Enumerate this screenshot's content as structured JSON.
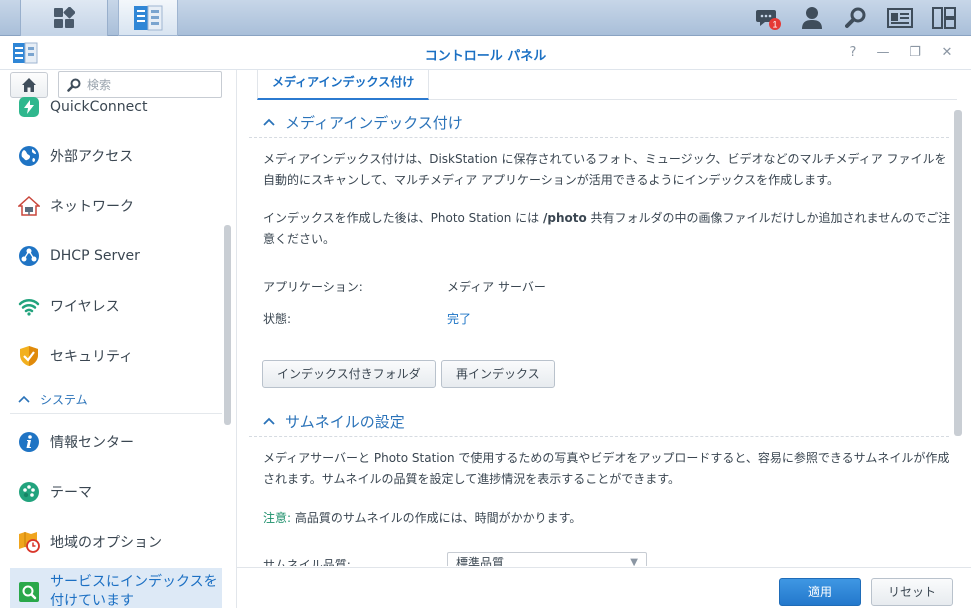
{
  "window": {
    "title": "コントロール パネル",
    "help": "?",
    "minimize": "—",
    "restore": "❐",
    "close": "✕"
  },
  "taskbar": {
    "notification_count": "1",
    "icons": [
      "main-menu-icon",
      "control-panel-app-icon",
      "notifications-icon",
      "user-icon",
      "search-icon",
      "widgets-icon",
      "desktop-layout-icon"
    ]
  },
  "sidebar": {
    "search_placeholder": "検索",
    "items": [
      {
        "label": "QuickConnect",
        "icon": "quickconnect-icon"
      },
      {
        "label": "外部アクセス",
        "icon": "globe-icon"
      },
      {
        "label": "ネットワーク",
        "icon": "network-house-icon"
      },
      {
        "label": "DHCP Server",
        "icon": "dhcp-icon"
      },
      {
        "label": "ワイヤレス",
        "icon": "wifi-icon"
      },
      {
        "label": "セキュリティ",
        "icon": "shield-icon"
      }
    ],
    "group_label": "システム",
    "group_items": [
      {
        "label": "情報センター",
        "icon": "info-icon"
      },
      {
        "label": "テーマ",
        "icon": "palette-icon"
      },
      {
        "label": "地域のオプション",
        "icon": "region-clock-icon"
      },
      {
        "label": "サービスにインデックスを付けています",
        "label_line1": "サービスにインデックスを",
        "label_line2": "付けています",
        "icon": "indexing-search-icon",
        "active": true
      }
    ]
  },
  "main": {
    "tab_label": "メディアインデックス付け",
    "section1": {
      "title": "メディアインデックス付け",
      "para1_line1": "メディアインデックス付けは、DiskStation に保存されているフォト、ミュージック、ビデオなどのマルチメディア ファイルを",
      "para1_line2": "自動的にスキャンして、マルチメディア アプリケーションが活用できるようにインデックスを作成します。",
      "para2_part1": "インデックスを作成した後は、Photo Station には ",
      "para2_bold": "/photo",
      "para2_part2": " 共有フォルダの中の画像ファイルだけしか追加されませんのでご注",
      "para2_line2": "意ください。",
      "app_label": "アプリケーション:",
      "app_value": "メディア サーバー",
      "status_label": "状態:",
      "status_value": "完了",
      "btn_indexed_folder": "インデックス付きフォルダ",
      "btn_reindex": "再インデックス"
    },
    "section2": {
      "title": "サムネイルの設定",
      "para1_line1": "メディアサーバーと Photo Station で使用するための写真やビデオをアップロードすると、容易に参照できるサムネイルが作成",
      "para1_line2": "されます。サムネイルの品質を設定して進捗情況を表示することができます。",
      "note_label": "注意:",
      "note_text": " 高品質のサムネイルの作成には、時間がかかります。",
      "quality_label": "サムネイル品質:",
      "quality_value": "標準品質"
    },
    "footer": {
      "apply": "適用",
      "reset": "リセット"
    }
  },
  "colors": {
    "accent": "#1b6fc3",
    "primary_button": "#2b82d6",
    "note": "#1b8f6a"
  }
}
